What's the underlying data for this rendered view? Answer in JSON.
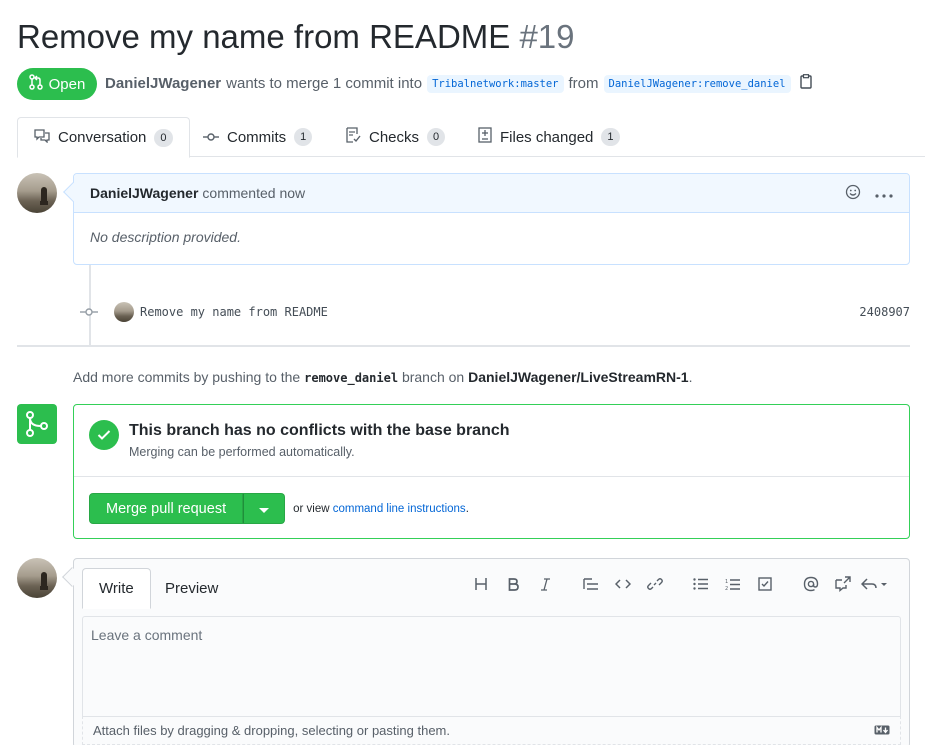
{
  "pr": {
    "title": "Remove my name from README",
    "number": "#19",
    "state": "Open",
    "author": "DanielJWagener",
    "merge_text": "wants to merge 1 commit into",
    "base_branch": "Tribalnetwork:master",
    "from_text": "from",
    "head_branch": "DanielJWagener:remove_daniel"
  },
  "tabs": [
    {
      "label": "Conversation",
      "count": "0",
      "icon": "conversation-icon"
    },
    {
      "label": "Commits",
      "count": "1",
      "icon": "commit-icon"
    },
    {
      "label": "Checks",
      "count": "0",
      "icon": "checklist-icon"
    },
    {
      "label": "Files changed",
      "count": "1",
      "icon": "diff-icon"
    }
  ],
  "comment": {
    "author": "DanielJWagener",
    "time": "commented now",
    "body": "No description provided."
  },
  "commit": {
    "message": "Remove my name from README",
    "sha": "2408907"
  },
  "push_hint": {
    "prefix": "Add more commits by pushing to the",
    "branch": "remove_daniel",
    "middle": "branch on",
    "repo": "DanielJWagener/LiveStreamRN-1",
    "suffix": "."
  },
  "merge": {
    "status": "This branch has no conflicts with the base branch",
    "sub": "Merging can be performed automatically.",
    "button": "Merge pull request",
    "alt_prefix": "or view",
    "alt_link": "command line instructions",
    "alt_suffix": "."
  },
  "editor": {
    "tab_write": "Write",
    "tab_preview": "Preview",
    "placeholder": "Leave a comment",
    "attach": "Attach files by dragging & dropping, selecting or pasting them.",
    "tools": [
      "header-icon",
      "bold-icon",
      "italic-icon",
      "quote-icon",
      "code-icon",
      "link-icon",
      "unordered-list-icon",
      "ordered-list-icon",
      "task-list-icon",
      "mention-icon",
      "cross-reference-icon",
      "reply-icon"
    ]
  },
  "colors": {
    "accent_green": "#2cbe4e",
    "link_blue": "#0366d6"
  }
}
